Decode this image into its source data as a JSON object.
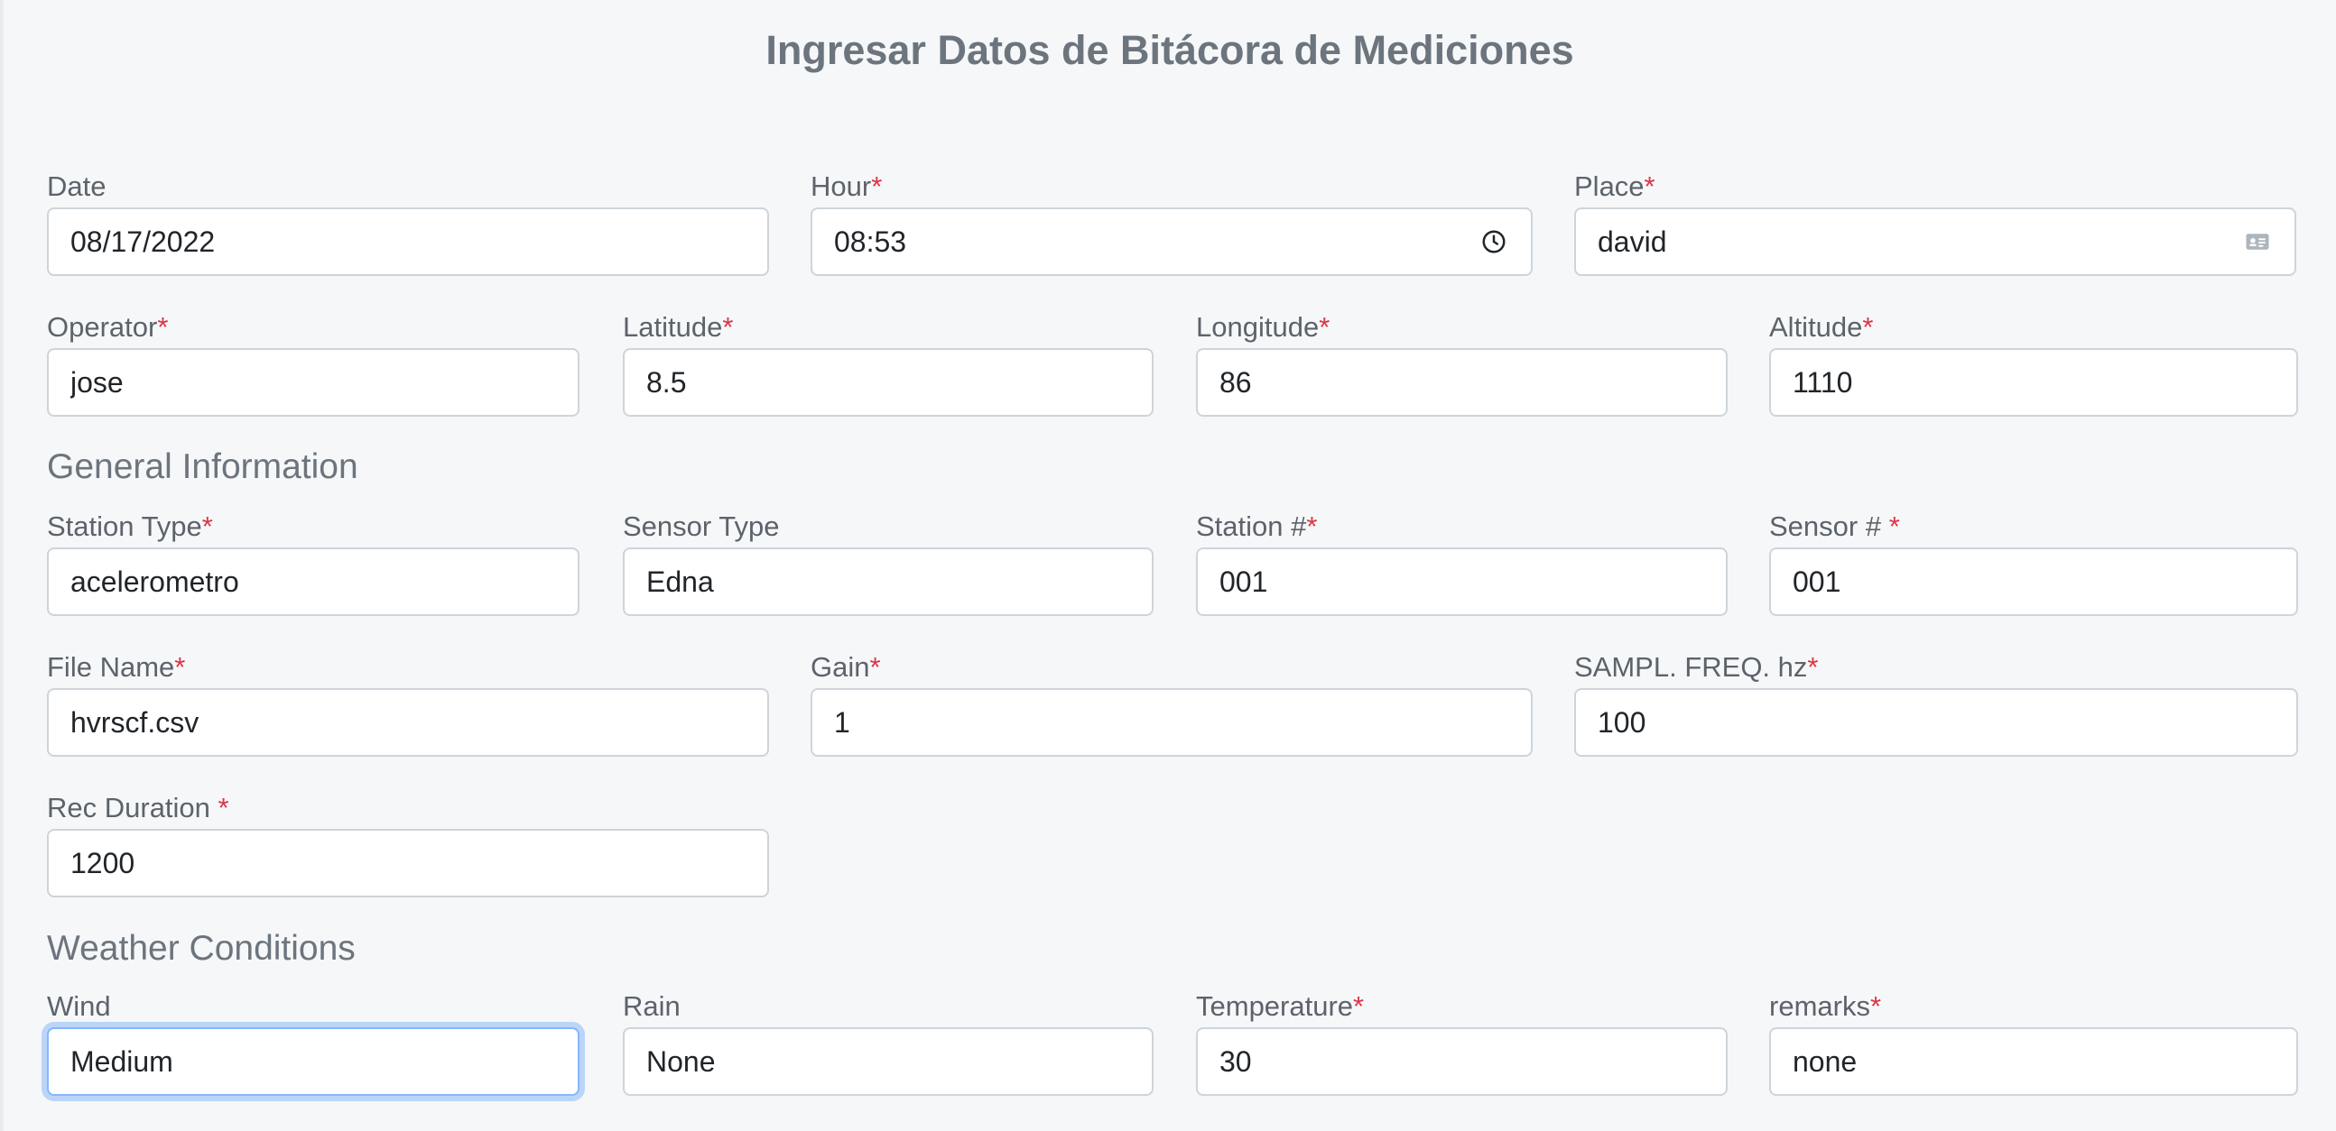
{
  "title": "Ingresar Datos de Bitácora de Mediciones",
  "sections": {
    "general": "General Information",
    "weather": "Weather Conditions"
  },
  "fields": {
    "date": {
      "label": "Date",
      "required": "",
      "value": "08/17/2022"
    },
    "hour": {
      "label": "Hour",
      "required": "*",
      "value": "08:53",
      "icon": "clock-icon"
    },
    "place": {
      "label": "Place",
      "required": "*",
      "value": "david",
      "icon": "contact-card-icon"
    },
    "operator": {
      "label": "Operator",
      "required": "*",
      "value": "jose"
    },
    "latitude": {
      "label": "Latitude",
      "required": "*",
      "value": "8.5"
    },
    "longitude": {
      "label": "Longitude",
      "required": "*",
      "value": "86"
    },
    "altitude": {
      "label": "Altitude",
      "required": "*",
      "value": "1110"
    },
    "station_type": {
      "label": "Station Type",
      "required": "*",
      "value": "acelerometro"
    },
    "sensor_type": {
      "label": "Sensor Type",
      "required": "",
      "value": "Edna"
    },
    "station_num": {
      "label": "Station #",
      "required": "*",
      "value": "001"
    },
    "sensor_num": {
      "label": "Sensor # ",
      "required": "*",
      "value": "001"
    },
    "file_name": {
      "label": "File Name",
      "required": "*",
      "value": "hvrscf.csv"
    },
    "gain": {
      "label": "Gain",
      "required": "*",
      "value": "1"
    },
    "sampl_freq": {
      "label": "SAMPL. FREQ. hz",
      "required": "*",
      "value": "100"
    },
    "rec_duration": {
      "label": "Rec Duration ",
      "required": "*",
      "value": "1200"
    },
    "wind": {
      "label": "Wind",
      "required": "",
      "value": "Medium"
    },
    "rain": {
      "label": "Rain",
      "required": "",
      "value": "None"
    },
    "temperature": {
      "label": "Temperature",
      "required": "*",
      "value": "30"
    },
    "remarks": {
      "label": "remarks",
      "required": "*",
      "value": "none"
    }
  },
  "colors": {
    "required": "#dc3545",
    "focus_border": "#86b7fe",
    "muted_text": "#6c757d"
  }
}
